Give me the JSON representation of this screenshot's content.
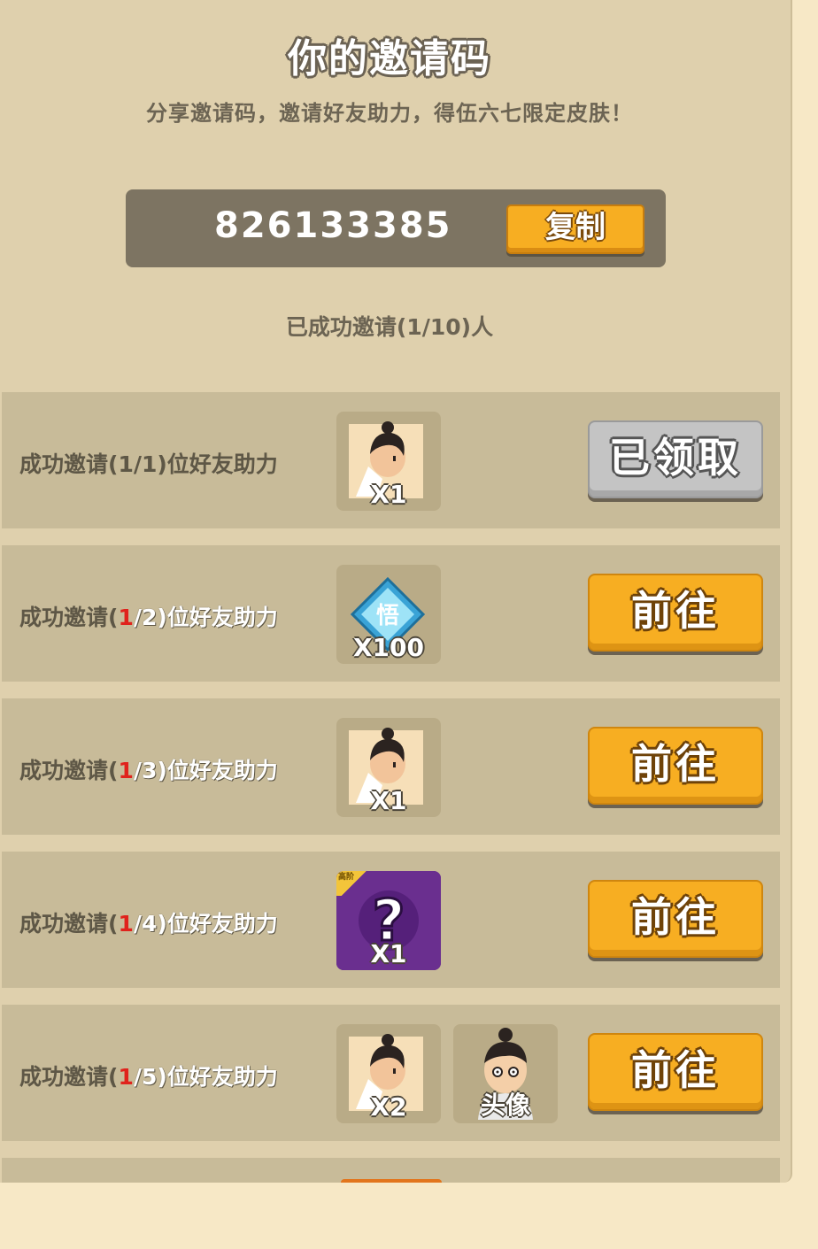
{
  "header": {
    "title": "你的邀请码",
    "subtitle": "分享邀请码，邀请好友助力，得伍六七限定皮肤！"
  },
  "invite": {
    "code": "826133385",
    "copy_label": "复制",
    "progress_text": "已成功邀请(1/10)人"
  },
  "tasks": [
    {
      "prefix": "成功邀请(",
      "current": "1",
      "slash_total": "/1)",
      "suffix": "位好友助力",
      "current_red": false,
      "rewards": [
        {
          "icon": "character-skin-icon",
          "qty": "X1"
        }
      ],
      "button": "已领取",
      "claimed": true
    },
    {
      "prefix": "成功邀请(",
      "current": "1",
      "slash_total": "/2)",
      "suffix": "位好友助力",
      "current_red": true,
      "rewards": [
        {
          "icon": "diamond-gem-icon",
          "qty": "X100",
          "gem_char": "悟"
        }
      ],
      "button": "前往",
      "claimed": false
    },
    {
      "prefix": "成功邀请(",
      "current": "1",
      "slash_total": "/3)",
      "suffix": "位好友助力",
      "current_red": true,
      "rewards": [
        {
          "icon": "character-skin-icon",
          "qty": "X1"
        }
      ],
      "button": "前往",
      "claimed": false
    },
    {
      "prefix": "成功邀请(",
      "current": "1",
      "slash_total": "/4)",
      "suffix": "位好友助力",
      "current_red": true,
      "rewards": [
        {
          "icon": "mystery-box-icon",
          "qty": "X1",
          "badge": "高阶"
        }
      ],
      "button": "前往",
      "claimed": false
    },
    {
      "prefix": "成功邀请(",
      "current": "1",
      "slash_total": "/5)",
      "suffix": "位好友助力",
      "current_red": true,
      "rewards": [
        {
          "icon": "character-skin-icon",
          "qty": "X2"
        },
        {
          "icon": "avatar-portrait-icon",
          "qty": "头像"
        }
      ],
      "button": "前往",
      "claimed": false
    }
  ],
  "colors": {
    "panel": "#dfd0ad",
    "row": "#c8bb99",
    "go_button": "#f7ae22",
    "claimed_button": "#c4c4c4",
    "highlight": "#e0221c"
  }
}
